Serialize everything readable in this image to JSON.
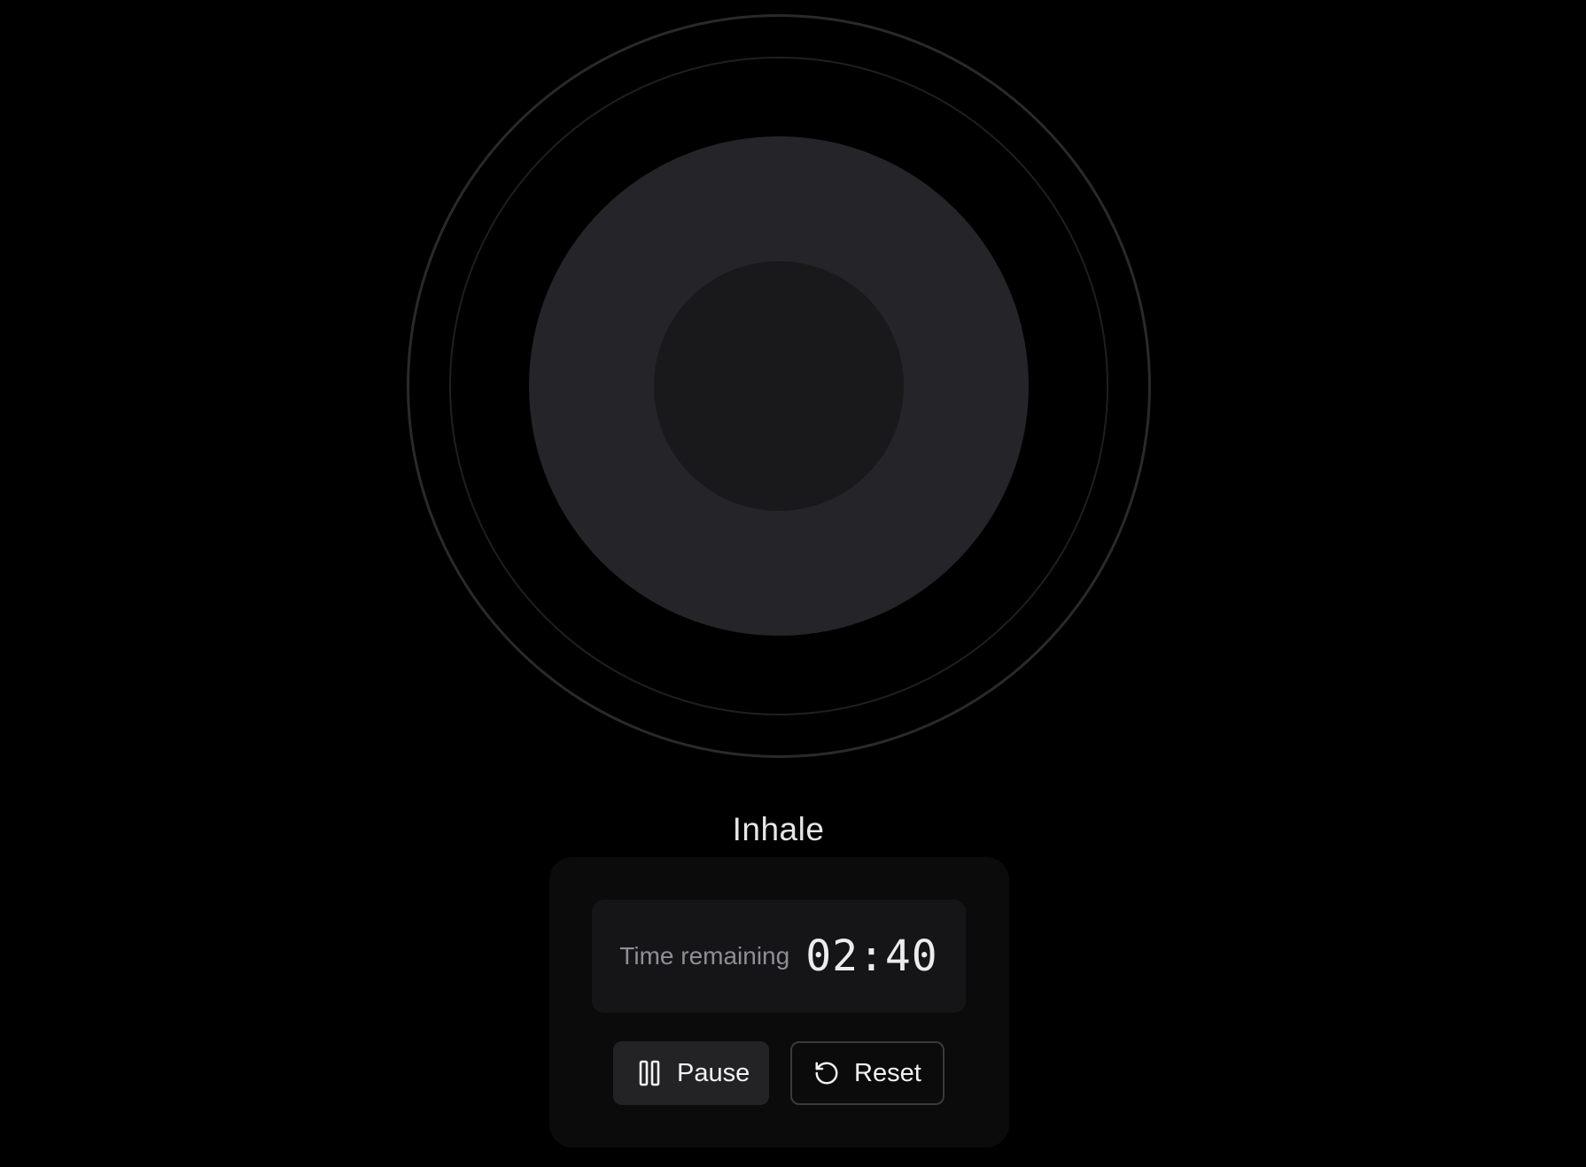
{
  "phase": {
    "label": "Inhale"
  },
  "timer": {
    "label": "Time remaining",
    "value": "02:40"
  },
  "controls": {
    "pause": {
      "label": "Pause",
      "icon": "pause-icon"
    },
    "reset": {
      "label": "Reset",
      "icon": "rotate-ccw-icon"
    }
  },
  "colors": {
    "background": "#000000",
    "disc_outer": "#252529",
    "disc_inner": "#19191b",
    "panel": "#0b0b0c",
    "text": "#ececec"
  }
}
